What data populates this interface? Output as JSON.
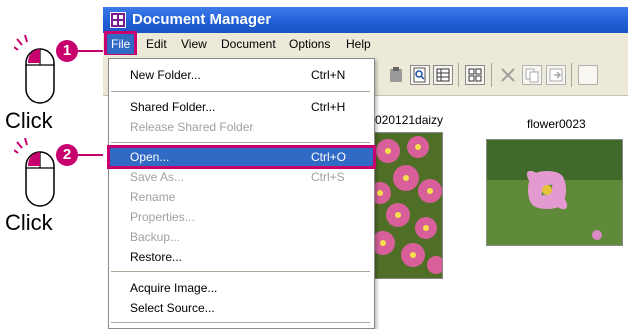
{
  "window": {
    "title": "Document Manager"
  },
  "menubar": {
    "items": [
      "File",
      "Edit",
      "View",
      "Document",
      "Options",
      "Help"
    ]
  },
  "file_menu": {
    "items": [
      {
        "label": "New Folder...",
        "shortcut": "Ctrl+N",
        "enabled": true
      },
      {
        "label": "Shared Folder...",
        "shortcut": "Ctrl+H",
        "enabled": true
      },
      {
        "label": "Release Shared Folder",
        "shortcut": "",
        "enabled": false
      },
      {
        "label": "Open...",
        "shortcut": "Ctrl+O",
        "enabled": true,
        "highlighted": true
      },
      {
        "label": "Save As...",
        "shortcut": "Ctrl+S",
        "enabled": false
      },
      {
        "label": "Rename",
        "shortcut": "",
        "enabled": false
      },
      {
        "label": "Properties...",
        "shortcut": "",
        "enabled": false
      },
      {
        "label": "Backup...",
        "shortcut": "",
        "enabled": false
      },
      {
        "label": "Restore...",
        "shortcut": "",
        "enabled": true
      },
      {
        "label": "Acquire Image...",
        "shortcut": "",
        "enabled": true
      },
      {
        "label": "Select Source...",
        "shortcut": "",
        "enabled": true
      }
    ]
  },
  "thumbnails": [
    {
      "name": "020121daizy"
    },
    {
      "name": "flower0023"
    }
  ],
  "instructions": {
    "steps": [
      {
        "number": "1",
        "label": "Click"
      },
      {
        "number": "2",
        "label": "Click"
      }
    ]
  },
  "colors": {
    "callout": "#c8006e",
    "selection": "#316ac5",
    "titlebar": "#1f5fd4"
  },
  "icons": [
    "mouse-icon",
    "app-icon",
    "paste-icon",
    "zoom-icon",
    "details-view-icon",
    "thumbnail-view-icon",
    "delete-icon",
    "copy-icon",
    "export-icon"
  ]
}
